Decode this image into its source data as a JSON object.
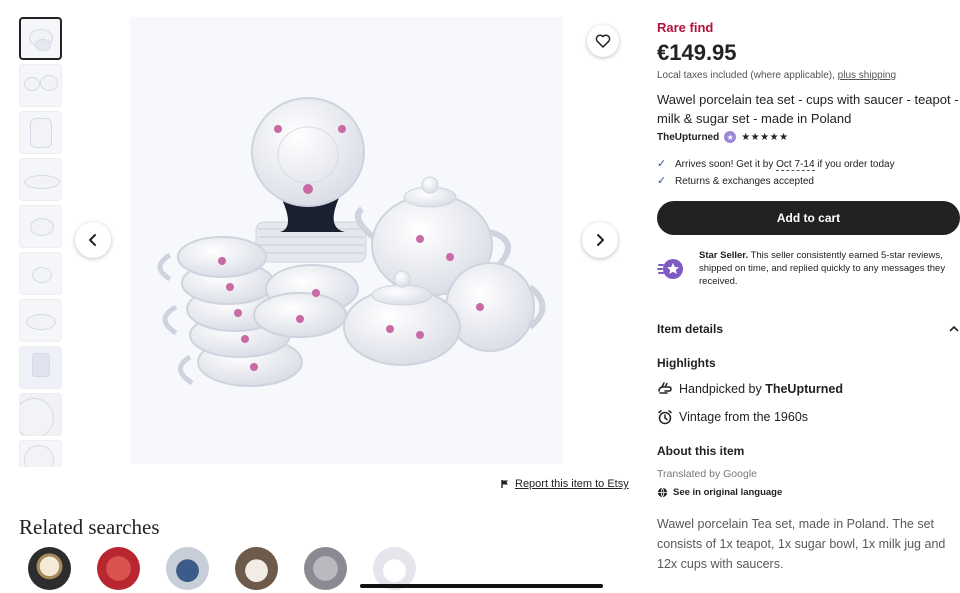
{
  "listing": {
    "badge": "Rare find",
    "price": "€149.95",
    "taxes_text": "Local taxes included (where applicable),",
    "shipping_link": "plus shipping",
    "title": "Wawel porcelain tea set - cups with saucer - teapot - milk & sugar set - made in Poland",
    "shop_name": "TheUpturned",
    "rating_stars": "★★★★★",
    "rating_value": 5
  },
  "shipping": {
    "arrives_prefix": "Arrives soon! Get it by",
    "arrives_date": "Oct 7-14",
    "arrives_suffix": "if you order today",
    "returns": "Returns & exchanges accepted"
  },
  "actions": {
    "add_to_cart": "Add to cart",
    "report": "Report this item to Etsy"
  },
  "star_seller": {
    "label": "Star Seller.",
    "text": "This seller consistently earned 5-star reviews, shipped on time, and replied quickly to any messages they received."
  },
  "sections": {
    "item_details": "Item details",
    "highlights": "Highlights",
    "about": "About this item",
    "related_searches": "Related searches"
  },
  "highlights": {
    "handpicked_prefix": "Handpicked by",
    "handpicked_shop": "TheUpturned",
    "vintage": "Vintage from the 1960s"
  },
  "about": {
    "translated_by": "Translated by Google",
    "see_original": "See in original language",
    "description": "Wawel porcelain Tea set, made in Poland. The set consists of 1x teapot, 1x sugar bowl, 1x milk jug and 12x cups with saucers."
  },
  "gallery": {
    "thumbnail_count": 10,
    "active_index": 0
  },
  "icons": {
    "favorite": "heart-icon",
    "prev": "chevron-left-icon",
    "next": "chevron-right-icon",
    "flag": "flag-icon",
    "check": "check-icon",
    "star_seller": "star-seller-icon",
    "expand": "chevron-down-icon",
    "hand": "hand-icon",
    "clock": "alarm-clock-icon",
    "globe": "globe-icon"
  },
  "colors": {
    "accent_red": "#b3123c",
    "button_dark": "#222222",
    "check_blue": "#2a56a8"
  }
}
